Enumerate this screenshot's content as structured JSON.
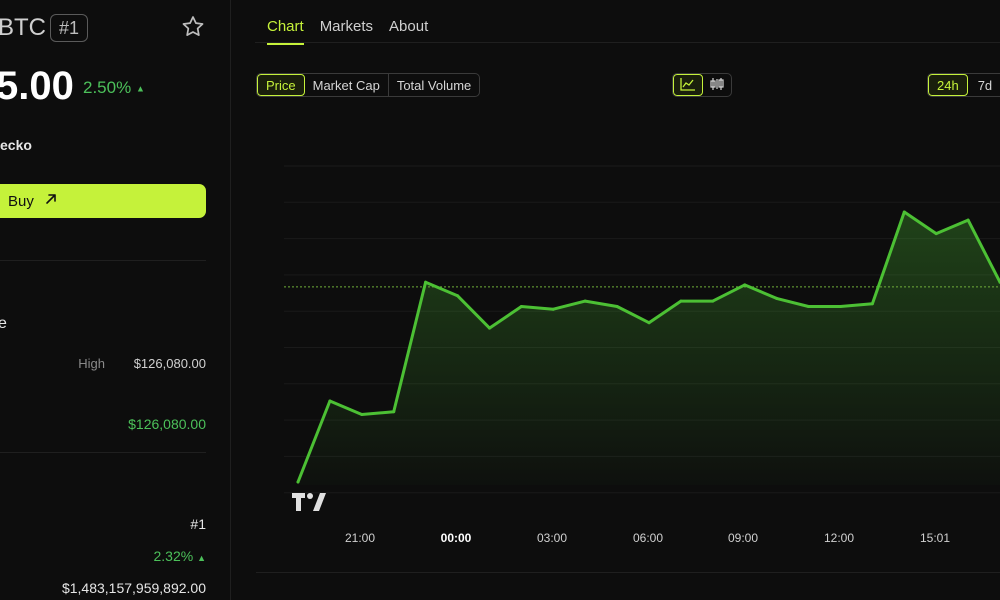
{
  "coin": {
    "symbol": "BTC",
    "rank_badge": "#1",
    "price": "5.00",
    "change": "2.50%",
    "change_arrow": "▲",
    "source": "ecko",
    "buy_label": "Buy"
  },
  "left_stats": {
    "range_label": "e",
    "high_label": "High",
    "high_value": "$126,080.00",
    "ath_value": "$126,080.00",
    "rank_value": "#1",
    "pct_value": "2.32%",
    "pct_arrow": "▲",
    "market_cap_value": "$1,483,157,959,892.00"
  },
  "tabs": [
    {
      "label": "Chart",
      "active": true
    },
    {
      "label": "Markets",
      "active": false
    },
    {
      "label": "About",
      "active": false
    }
  ],
  "metric_buttons": [
    "Price",
    "Market Cap",
    "Total Volume"
  ],
  "selected_metric": "Price",
  "chart_type_icons": [
    "line-chart-icon",
    "candlestick-icon"
  ],
  "selected_chart_type": "line-chart-icon",
  "range_buttons": [
    "24h",
    "7d"
  ],
  "selected_range": "24h",
  "colors": {
    "accent": "#c5f23a",
    "up": "#4cc05a",
    "line": "#4cc034"
  },
  "chart_data": {
    "type": "area",
    "x_ticks": [
      "21:00",
      "00:00",
      "03:00",
      "06:00",
      "09:00",
      "12:00",
      "15:01"
    ],
    "bold_tick": "00:00",
    "grid": true,
    "reference_line": true,
    "series": [
      {
        "values": [
          0.0,
          0.3,
          0.25,
          0.26,
          0.74,
          0.69,
          0.57,
          0.65,
          0.64,
          0.67,
          0.65,
          0.59,
          0.67,
          0.67,
          0.73,
          0.68,
          0.65,
          0.65,
          0.66,
          1.0,
          0.92,
          0.97,
          0.74
        ]
      }
    ]
  }
}
